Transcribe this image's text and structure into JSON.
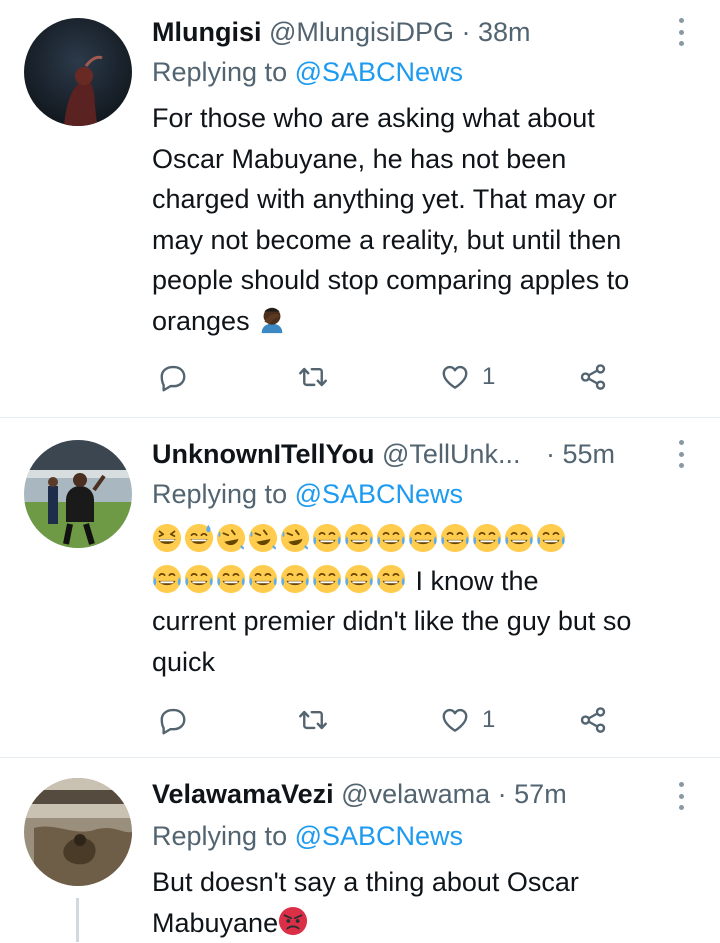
{
  "tweets": [
    {
      "name": "Mlungisi",
      "handle": "@MlungisiDPG",
      "dot": "·",
      "time": "38m",
      "replying_prefix": "Replying to ",
      "replying_to": "@SABCNews",
      "text": "For those who are asking what about\nOscar Mabuyane, he has not been\ncharged with anything yet. That may or\nmay not become a reality, but until then\npeople should stop comparing apples to\noranges",
      "emoji_after": "facepalm-emoji",
      "like_count": "1"
    },
    {
      "name": "UnknownITellYou",
      "handle": "@TellUnk...",
      "dot": "·",
      "time": "55m",
      "replying_prefix": "Replying to ",
      "replying_to": "@SABCNews",
      "text_after_emojis": " I know the\ncurrent premier didn't like the guy but so\nquick",
      "emoji_line1": [
        "grinning-squint-emoji",
        "grin-sweat-emoji",
        "rofl-emoji",
        "rofl-emoji",
        "rofl-emoji",
        "joy-emoji",
        "joy-emoji",
        "joy-emoji",
        "joy-emoji",
        "joy-emoji",
        "joy-emoji",
        "joy-emoji",
        "joy-emoji"
      ],
      "emoji_line2_count": 8,
      "like_count": "1"
    },
    {
      "name": "VelawamaVezi",
      "handle": "@velawama",
      "dot": "·",
      "time": "57m",
      "replying_prefix": "Replying to ",
      "replying_to": "@SABCNews",
      "text": "But doesn't say a thing about Oscar\nMabuyane",
      "emoji_after": "angry-face-emoji"
    }
  ],
  "icons": {
    "reply": "reply-icon",
    "retweet": "retweet-icon",
    "like": "heart-icon",
    "share": "share-icon",
    "more": "more-icon"
  },
  "colors": {
    "accent": "#1d9bf0",
    "secondary_text": "#536471",
    "primary_text": "#0f1419"
  }
}
